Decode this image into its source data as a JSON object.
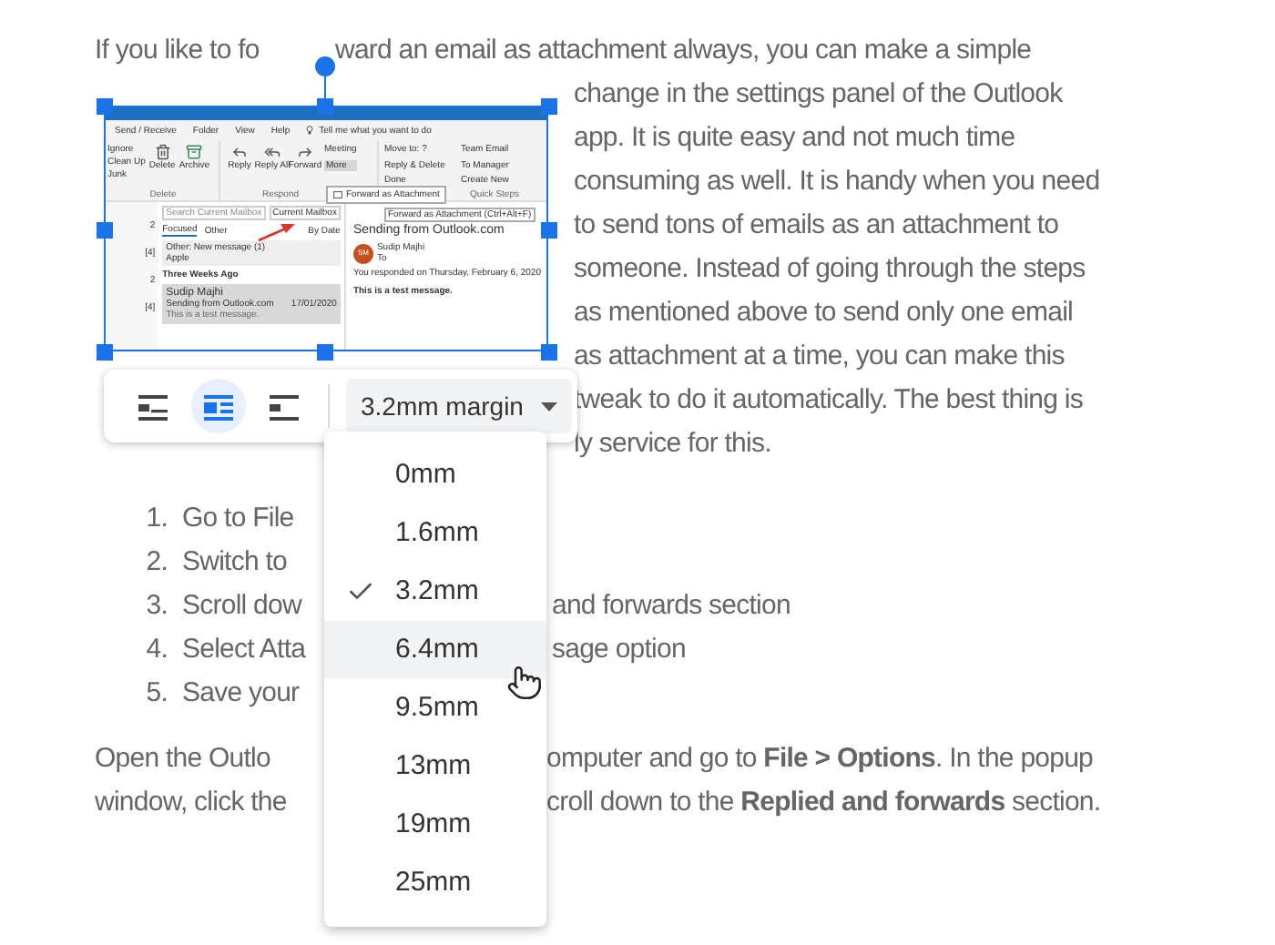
{
  "document": {
    "first_line": [
      "If you like to fo",
      "ward an email as attachment always, you can make a simple"
    ],
    "wrapped_lines": [
      "change in the settings panel of the Outlook",
      "app. It is quite easy and not much time",
      "consuming as well. It is handy when you need",
      "to send tons of emails as an attachment to",
      "someone. Instead of going through the steps",
      "as mentioned above to send only one email",
      "as attachment at a time, you can make this",
      "tweak to do it automatically. The best thing is",
      "ly service for this."
    ],
    "steps": [
      {
        "number": "1.",
        "left": "Go to File"
      },
      {
        "number": "2.",
        "left": "Switch to"
      },
      {
        "number": "3.",
        "left": "Scroll dow",
        "right": "and forwards section"
      },
      {
        "number": "4.",
        "left": "Select Atta",
        "right": "sage option"
      },
      {
        "number": "5.",
        "left": "Save your"
      }
    ],
    "closing_lines": [
      {
        "left": "Open the Outlo",
        "right": "omputer and go to **File > Options**. In the popup"
      },
      {
        "left": "window, click the",
        "right": "croll down to the **Replied and forwards** section."
      }
    ]
  },
  "image": {
    "ribbon_tabs": [
      "Send / Receive",
      "Folder",
      "View",
      "Help"
    ],
    "tell_me": "Tell me what you want to do",
    "delete_group": {
      "small": [
        "Ignore",
        "Clean Up",
        "Junk"
      ],
      "buttons": [
        "Delete",
        "Archive"
      ],
      "label": "Delete"
    },
    "respond_group": {
      "buttons": [
        "Reply",
        "Reply All",
        "Forward"
      ],
      "small": [
        "Meeting",
        "More"
      ],
      "label": "Respond"
    },
    "quick_steps": {
      "items": [
        "Move to: ?",
        "Team Email",
        "Reply & Delete",
        "To Manager",
        "Done",
        "Create New"
      ],
      "label": "Quick Steps"
    },
    "popup_item": "Forward as Attachment",
    "tooltip": "Forward as Attachment (Ctrl+Alt+F)",
    "folder_counts": [
      "2",
      "[4]",
      "2",
      "[4]"
    ],
    "search_placeholder": "Search Current Mailbox",
    "scope": "Current Mailbox",
    "list_tabs": [
      {
        "label": "Focused",
        "selected": true
      },
      {
        "label": "Other",
        "selected": false
      }
    ],
    "sort": "By Date",
    "messages": [
      {
        "kind": "notice",
        "title": "Other: New message (1)",
        "sender": "Apple"
      },
      {
        "kind": "header",
        "title": "Three Weeks Ago"
      },
      {
        "kind": "mail",
        "sender": "Sudip Majhi",
        "subject": "Sending from Outlook.com",
        "date": "17/01/2020",
        "preview": "This is a test message."
      }
    ],
    "reading": {
      "subject": "Sending from Outlook.com",
      "initials": "SM",
      "sender": "Sudip Majhi",
      "to": "To",
      "responded": "You responded on Thursday, February 6, 2020",
      "body": "This is a test message."
    }
  },
  "image_toolbar": {
    "wrap_options": [
      {
        "kind": "inline",
        "selected": false
      },
      {
        "kind": "wrap",
        "selected": true
      },
      {
        "kind": "break",
        "selected": false
      }
    ],
    "margin_dropdown": "3.2mm margin"
  },
  "margin_menu": {
    "options": [
      {
        "label": "0mm",
        "checked": false,
        "hovered": false
      },
      {
        "label": "1.6mm",
        "checked": false,
        "hovered": false
      },
      {
        "label": "3.2mm",
        "checked": true,
        "hovered": false
      },
      {
        "label": "6.4mm",
        "checked": false,
        "hovered": true
      },
      {
        "label": "9.5mm",
        "checked": false,
        "hovered": false
      },
      {
        "label": "13mm",
        "checked": false,
        "hovered": false
      },
      {
        "label": "19mm",
        "checked": false,
        "hovered": false
      },
      {
        "label": "25mm",
        "checked": false,
        "hovered": false
      }
    ]
  }
}
